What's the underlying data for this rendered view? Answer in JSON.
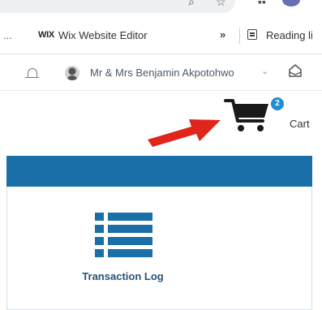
{
  "bookmarks": {
    "overflow_text": "...",
    "wix_logo": "WIX",
    "wix_label": "Wix Website Editor",
    "more_label": "»",
    "reading_list_label": "Reading li"
  },
  "user": {
    "name": "Mr & Mrs Benjamin Akpotohwo"
  },
  "cart": {
    "badge_count": "2",
    "label": "Cart"
  },
  "card": {
    "title": "Transaction Log"
  },
  "colors": {
    "header_blue": "#1a6fa8",
    "badge_blue": "#1d8fd6",
    "arrow_red": "#e0251b"
  }
}
